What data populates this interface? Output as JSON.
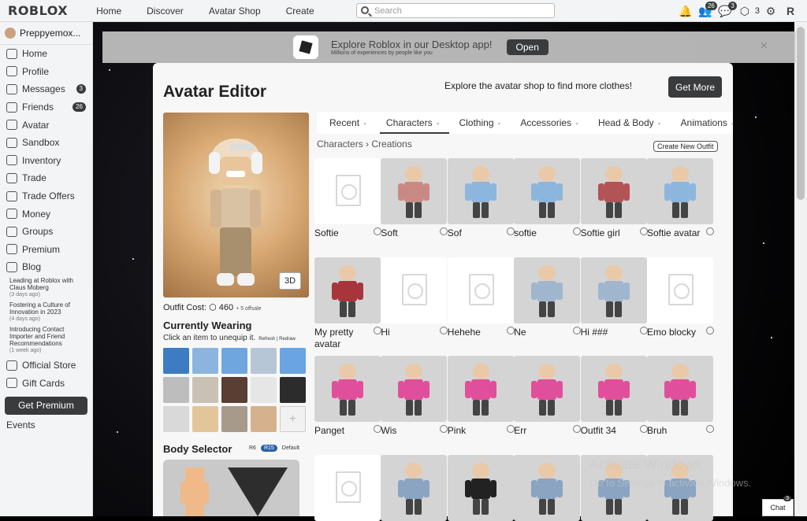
{
  "topbar": {
    "logo": "ROBLOX",
    "nav": [
      "Home",
      "Discover",
      "Avatar Shop",
      "Create"
    ],
    "search_placeholder": "Search",
    "friends_badge": "26",
    "messages_badge": "3",
    "robux_count": "3"
  },
  "sidebar": {
    "username": "Preppyemox...",
    "items": [
      {
        "label": "Home",
        "icon": "home-icon"
      },
      {
        "label": "Profile",
        "icon": "profile-icon"
      },
      {
        "label": "Messages",
        "icon": "messages-icon",
        "count": "3"
      },
      {
        "label": "Friends",
        "icon": "friends-icon",
        "count": "26"
      },
      {
        "label": "Avatar",
        "icon": "avatar-icon"
      },
      {
        "label": "Sandbox",
        "icon": "sandbox-icon"
      },
      {
        "label": "Inventory",
        "icon": "inventory-icon"
      },
      {
        "label": "Trade",
        "icon": "trade-icon"
      },
      {
        "label": "Trade Offers",
        "icon": "trade-offers-icon"
      },
      {
        "label": "Money",
        "icon": "money-icon"
      },
      {
        "label": "Groups",
        "icon": "groups-icon"
      },
      {
        "label": "Premium",
        "icon": "premium-icon"
      },
      {
        "label": "Blog",
        "icon": "blog-icon"
      }
    ],
    "blog_posts": [
      {
        "title": "Leading at Roblox with Claus Moberg",
        "date": "(3 days ago)"
      },
      {
        "title": "Fostering a Culture of Innovation in 2023",
        "date": "(4 days ago)"
      },
      {
        "title": "Introducing Contact Importer and Friend Recommendations",
        "date": "(1 week ago)"
      }
    ],
    "store": "Official Store",
    "giftcards": "Gift Cards",
    "get_premium": "Get Premium",
    "events": "Events"
  },
  "banner": {
    "title": "Explore Roblox in our Desktop app!",
    "subtitle": "Millions of experiences by people like you",
    "open": "Open",
    "close": "×"
  },
  "editor": {
    "title": "Avatar Editor",
    "explore": "Explore the avatar shop to find more clothes!",
    "get_more": "Get More",
    "btn3d": "3D",
    "outfit_cost_label": "Outfit Cost:",
    "outfit_cost": "460",
    "offsale": "+ 5 offsale",
    "currently_wearing": "Currently Wearing",
    "cw_hint": "Click an item to unequip it.",
    "refresh": "Refresh | Redraw",
    "plus": "+",
    "body_selector": "Body Selector",
    "r6": "R6",
    "r15": "R15",
    "default": "Default"
  },
  "tabs": [
    "Recent",
    "Characters",
    "Clothing",
    "Accessories",
    "Head & Body",
    "Animations"
  ],
  "breadcrumb": {
    "root": "Characters",
    "sep": "›",
    "current": "Creations"
  },
  "new_outfit": "Create New Outfit",
  "outfits": [
    {
      "name": "Softie",
      "empty": true
    },
    {
      "name": "Soft",
      "color": "#c98a86"
    },
    {
      "name": "Sof",
      "color": "#8cb6dd"
    },
    {
      "name": "softie",
      "color": "#8cb6dd"
    },
    {
      "name": "Softie girl",
      "color": "#b25356"
    },
    {
      "name": "Softie avatar",
      "color": "#8cb6dd"
    },
    {
      "name": "My pretty avatar",
      "color": "#a8353b"
    },
    {
      "name": "Hi",
      "empty": true
    },
    {
      "name": "Hehehe",
      "empty": true
    },
    {
      "name": "Ne",
      "color": "#9fb6ce"
    },
    {
      "name": "Hi ###",
      "color": "#9fb6ce"
    },
    {
      "name": "Emo blocky",
      "empty": true
    },
    {
      "name": "Panget",
      "color": "#e04f9b"
    },
    {
      "name": "Wis",
      "color": "#e04f9b"
    },
    {
      "name": "Pink",
      "color": "#e04f9b"
    },
    {
      "name": "Err",
      "color": "#e04f9b"
    },
    {
      "name": "Outfit 34",
      "color": "#e04f9b"
    },
    {
      "name": "Bruh",
      "color": "#e04f9b"
    },
    {
      "name": "",
      "empty": true
    },
    {
      "name": "",
      "color": "#8aa4c2"
    },
    {
      "name": "",
      "color": "#222222"
    },
    {
      "name": "",
      "color": "#8aa4c2"
    },
    {
      "name": "",
      "color": "#8aa4c2"
    },
    {
      "name": "",
      "color": "#8aa4c2"
    }
  ],
  "watermark": {
    "line1": "Activate Windows",
    "line2": "Go to Settings to activate Windows."
  },
  "chat": {
    "label": "Chat",
    "badge": "3"
  }
}
